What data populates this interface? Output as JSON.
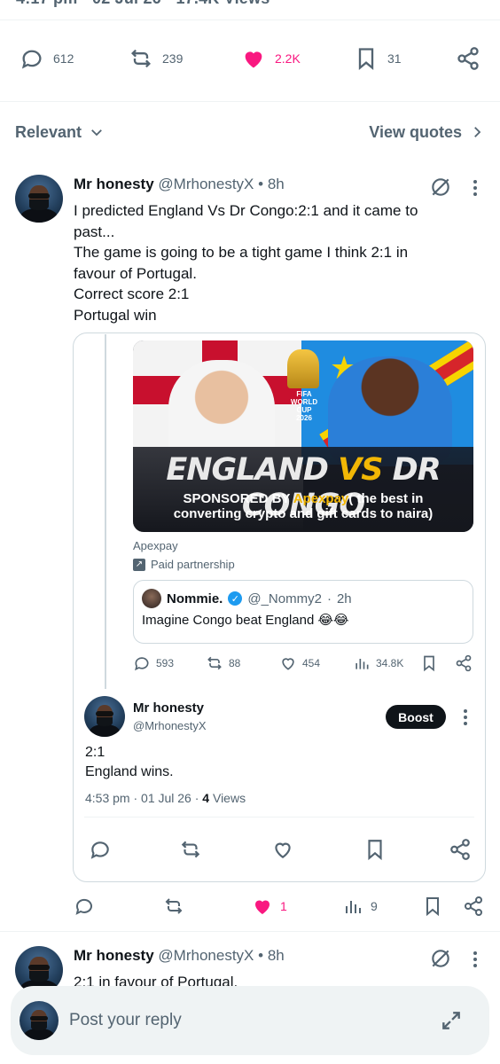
{
  "topbar": {
    "partial_text": "4:17 pm · 02 Jul 26 · 17.4K Views"
  },
  "stats": {
    "replies": "612",
    "reposts": "239",
    "likes": "2.2K",
    "bookmarks": "31",
    "like_color": "#f91880"
  },
  "sort": {
    "label": "Relevant",
    "quotes_label": "View quotes"
  },
  "reply1": {
    "name": "Mr honesty",
    "handle": "@MrhonestyX",
    "time": "8h",
    "lines": [
      "I predicted England Vs Dr Congo:2:1 and it came to",
      "past...",
      "The game is going to be a tight game I think 2:1 in",
      "favour of Portugal.",
      "Correct score 2:1",
      "Portugal win"
    ]
  },
  "ad": {
    "banner_fifa": "FIFA\nWORLD CUP\n2026",
    "banner_left": "ENGLAND",
    "banner_vs": "VS",
    "banner_right": "DR CONGO",
    "sponsor_prefix": "SPONSORED BY ",
    "sponsor_brand": "Apexpay",
    "sponsor_rest": "( the best in",
    "sponsor_line2": "converting crypto and gift cards to naira)",
    "advertiser": "Apexpay",
    "paid": "Paid partnership",
    "quote": {
      "name": "Nommie.",
      "handle": "@_Nommy2",
      "time": "2h",
      "text": "Imagine Congo beat England 😂😂"
    },
    "stats": {
      "replies": "593",
      "reposts": "88",
      "likes": "454",
      "views": "34.8K"
    }
  },
  "self_reply": {
    "name": "Mr honesty",
    "handle": "@MrhonestyX",
    "boost_label": "Boost",
    "line1": "2:1",
    "line2": "England wins.",
    "time": "4:53 pm · 01 Jul 26 · ",
    "views_count": "4",
    "views_label": " Views"
  },
  "reply1_stats": {
    "likes": "1",
    "views": "9"
  },
  "reply2": {
    "name": "Mr honesty",
    "handle": "@MrhonestyX",
    "time": "8h",
    "text": "2:1 in favour of Portugal."
  },
  "composer": {
    "placeholder": "Post your reply"
  }
}
